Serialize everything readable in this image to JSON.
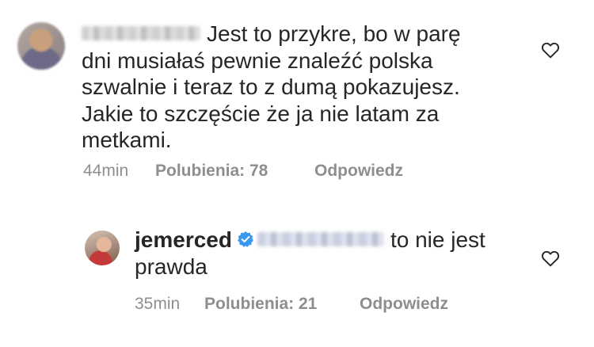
{
  "comments": [
    {
      "username": "",
      "text_lines": [
        "Jest to przykre, bo w parę",
        "dni musiałaś pewnie znaleźć polska",
        "szwalnie i teraz to z dumą pokazujesz.",
        "Jakie to szczęście że ja nie latam za",
        "metkami."
      ],
      "time": "44min",
      "likes_label": "Polubienia: 78",
      "reply_label": "Odpowiedz"
    },
    {
      "username": "jemerced",
      "verified": true,
      "text_lines": [
        "to nie jest",
        "prawda"
      ],
      "time": "35min",
      "likes_label": "Polubienia: 21",
      "reply_label": "Odpowiedz"
    }
  ],
  "icons": {
    "like": "heart-outline-icon",
    "verified": "verified-badge-icon"
  },
  "colors": {
    "text": "#262626",
    "meta": "#8e8e8e",
    "verified": "#3897f0"
  }
}
